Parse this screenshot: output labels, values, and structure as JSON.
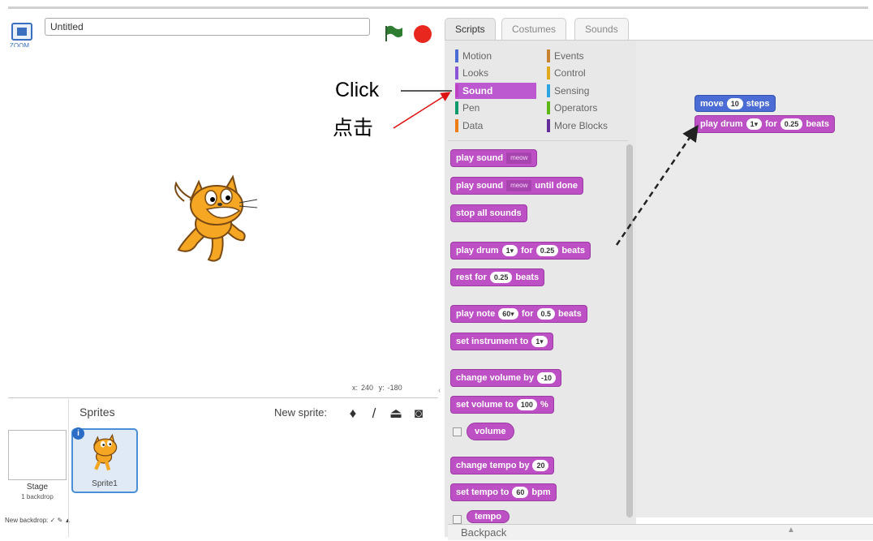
{
  "project": {
    "title": "Untitled",
    "zoom_label": "ZOOM"
  },
  "stage": {
    "x_label": "x:",
    "x_value": "240",
    "y_label": "y:",
    "y_value": "-180"
  },
  "stage_panel": {
    "label": "Stage",
    "sub": "1 backdrop",
    "new_backdrop": "New backdrop:"
  },
  "sprites": {
    "label": "Sprites",
    "new_sprite_label": "New sprite:",
    "items": [
      {
        "name": "Sprite1"
      }
    ]
  },
  "tabs": [
    {
      "label": "Scripts"
    },
    {
      "label": "Costumes"
    },
    {
      "label": "Sounds"
    }
  ],
  "categories": {
    "left": [
      {
        "label": "Motion",
        "color": "#4a6cd4"
      },
      {
        "label": "Looks",
        "color": "#8a55d7"
      },
      {
        "label": "Sound",
        "color": "#bb42c3"
      },
      {
        "label": "Pen",
        "color": "#0e9a6c"
      },
      {
        "label": "Data",
        "color": "#ee7d16"
      }
    ],
    "right": [
      {
        "label": "Events",
        "color": "#c88330"
      },
      {
        "label": "Control",
        "color": "#e1a91a"
      },
      {
        "label": "Sensing",
        "color": "#2ca5e2"
      },
      {
        "label": "Operators",
        "color": "#5cb712"
      },
      {
        "label": "More Blocks",
        "color": "#632d99"
      }
    ]
  },
  "blocks": {
    "play_sound": {
      "text": "play sound",
      "dropdown": "meow"
    },
    "play_sound_until": {
      "text": "play sound",
      "dropdown": "meow",
      "suffix": "until done"
    },
    "stop_all": {
      "text": "stop all sounds"
    },
    "play_drum": {
      "text": "play drum",
      "arg1": "1▾",
      "mid": "for",
      "arg2": "0.25",
      "suffix": "beats"
    },
    "rest": {
      "text": "rest for",
      "arg": "0.25",
      "suffix": "beats"
    },
    "play_note": {
      "text": "play note",
      "arg1": "60▾",
      "mid": "for",
      "arg2": "0.5",
      "suffix": "beats"
    },
    "set_instrument": {
      "text": "set instrument to",
      "arg": "1▾"
    },
    "change_volume": {
      "text": "change volume by",
      "arg": "-10"
    },
    "set_volume": {
      "text": "set volume to",
      "arg": "100",
      "suffix": "%"
    },
    "volume": {
      "text": "volume"
    },
    "change_tempo": {
      "text": "change tempo by",
      "arg": "20"
    },
    "set_tempo": {
      "text": "set tempo to",
      "arg": "60",
      "suffix": "bpm"
    },
    "tempo": {
      "text": "tempo"
    }
  },
  "script": {
    "move": {
      "text": "move",
      "arg": "10",
      "suffix": "steps"
    },
    "play_drum": {
      "text": "play drum",
      "arg1": "1▾",
      "mid": "for",
      "arg2": "0.25",
      "suffix": "beats"
    }
  },
  "backpack": {
    "label": "Backpack"
  },
  "annotation": {
    "click": "Click",
    "click_cn": "点击"
  },
  "colors": {
    "sound": "#bd50c5",
    "motion": "#4a6cd4",
    "stop": "#e8281e",
    "flag": "#2e7d32"
  }
}
